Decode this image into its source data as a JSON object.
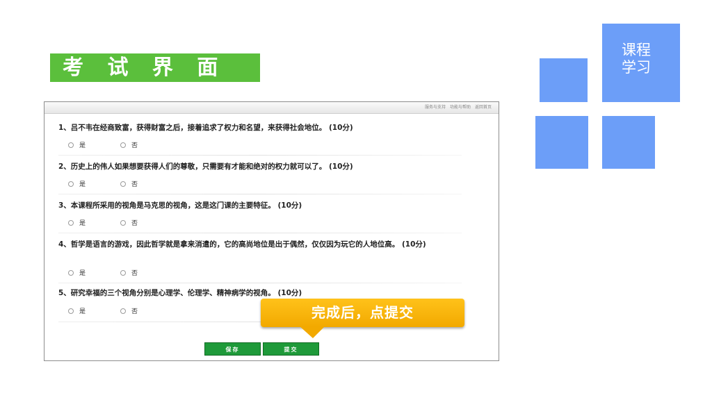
{
  "header": {
    "title": "考 试 界 面"
  },
  "side": {
    "course_label": "课程\n学习"
  },
  "window": {
    "top_links": [
      "服务与支持",
      "功能与帮助",
      "返回首页"
    ],
    "questions": [
      {
        "text": "1、吕不韦在经商致富，获得财富之后，接着追求了权力和名望，来获得社会地位。 (10分)",
        "options": [
          "是",
          "否"
        ]
      },
      {
        "text": "2、历史上的伟人如果想要获得人们的尊敬，只需要有才能和绝对的权力就可以了。 (10分)",
        "options": [
          "是",
          "否"
        ]
      },
      {
        "text": "3、本课程所采用的视角是马克思的视角，这是这门课的主要特征。 (10分)",
        "options": [
          "是",
          "否"
        ]
      },
      {
        "text": "4、哲学是语言的游戏，因此哲学就是拿来消遣的，它的高尚地位是出于偶然，仅仅因为玩它的人地位高。 (10分)",
        "options": [
          "是",
          "否"
        ]
      },
      {
        "text": "5、研究幸福的三个视角分别是心理学、伦理学、精神病学的视角。 (10分)",
        "options": [
          "是",
          "否"
        ]
      }
    ],
    "buttons": {
      "save": "保存",
      "submit": "提交"
    }
  },
  "callout": {
    "text": "完成后，点提交"
  },
  "colors": {
    "banner": "#5bbf3c",
    "squares": "#6c9ef8",
    "button": "#1f9a3a",
    "callout": "#f5b000"
  }
}
